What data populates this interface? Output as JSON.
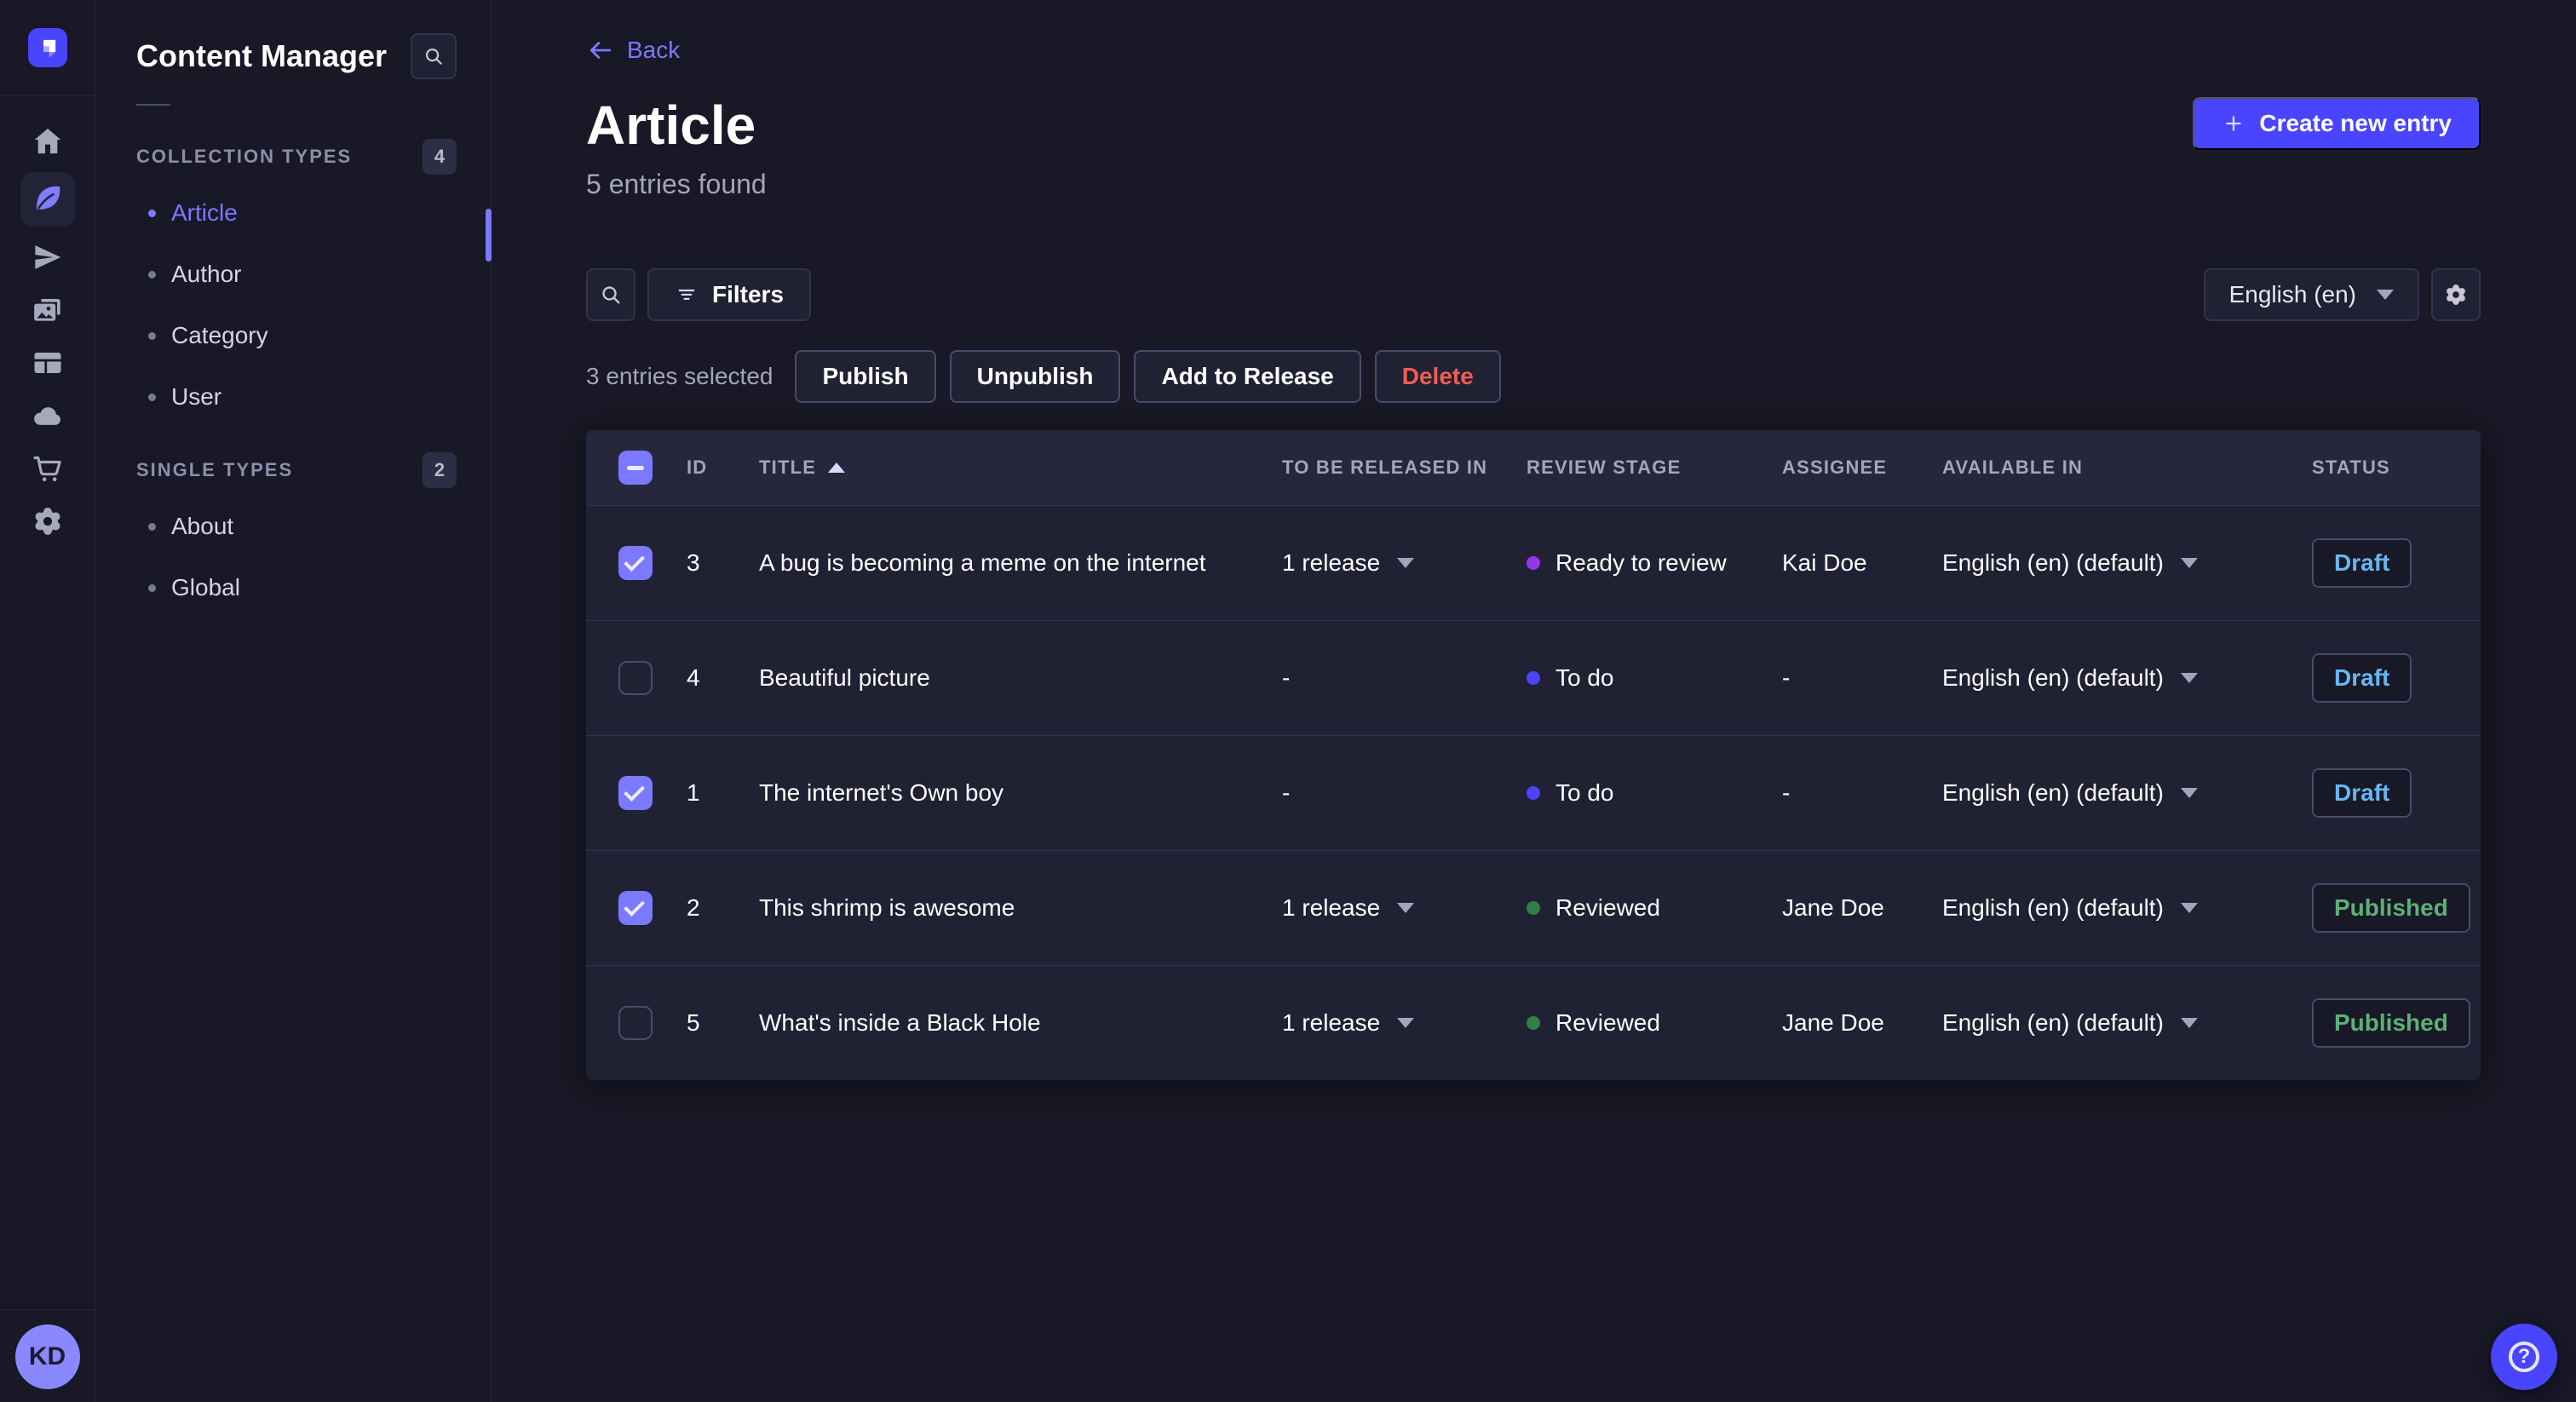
{
  "colors": {
    "primary": "#4945ff",
    "primary_light": "#7b79ff",
    "draft_text": "#66b7f1",
    "published_text": "#5cb176",
    "danger_text": "#ee5e52",
    "stage_ready_to_review": "#9736e8",
    "stage_to_do": "#4945ff",
    "stage_reviewed": "#328048"
  },
  "rail": {
    "avatar_initials": "KD",
    "icons": [
      "strapi-logo",
      "home",
      "content-manager",
      "releases",
      "media-library",
      "content-type-builder",
      "cloud",
      "marketplace",
      "settings"
    ],
    "active": "content-manager"
  },
  "subnav": {
    "title": "Content Manager",
    "sections": [
      {
        "label": "COLLECTION TYPES",
        "count": "4",
        "items": [
          {
            "label": "Article",
            "active": true
          },
          {
            "label": "Author",
            "active": false
          },
          {
            "label": "Category",
            "active": false
          },
          {
            "label": "User",
            "active": false
          }
        ]
      },
      {
        "label": "SINGLE TYPES",
        "count": "2",
        "items": [
          {
            "label": "About",
            "active": false
          },
          {
            "label": "Global",
            "active": false
          }
        ]
      }
    ]
  },
  "header": {
    "back_label": "Back",
    "title": "Article",
    "subtitle": "5 entries found",
    "create_label": "Create new entry"
  },
  "toolbar": {
    "filters_label": "Filters",
    "locale": "English (en)"
  },
  "selection": {
    "summary": "3 entries selected",
    "actions": [
      "Publish",
      "Unpublish",
      "Add to Release",
      "Delete"
    ]
  },
  "table": {
    "columns": [
      "ID",
      "TITLE",
      "TO BE RELEASED IN",
      "REVIEW STAGE",
      "ASSIGNEE",
      "AVAILABLE IN",
      "STATUS"
    ],
    "sort": {
      "column": "TITLE",
      "direction": "asc"
    },
    "rows": [
      {
        "checked": true,
        "id": "3",
        "title": "A bug is becoming a meme on the internet",
        "released_in": "1 release",
        "stage": "Ready to review",
        "assignee": "Kai Doe",
        "available_in": "English (en) (default)",
        "status": "Draft"
      },
      {
        "checked": false,
        "id": "4",
        "title": "Beautiful picture",
        "released_in": "-",
        "stage": "To do",
        "assignee": "-",
        "available_in": "English (en) (default)",
        "status": "Draft"
      },
      {
        "checked": true,
        "id": "1",
        "title": "The internet's Own boy",
        "released_in": "-",
        "stage": "To do",
        "assignee": "-",
        "available_in": "English (en) (default)",
        "status": "Draft"
      },
      {
        "checked": true,
        "id": "2",
        "title": "This shrimp is awesome",
        "released_in": "1 release",
        "stage": "Reviewed",
        "assignee": "Jane Doe",
        "available_in": "English (en) (default)",
        "status": "Published"
      },
      {
        "checked": false,
        "id": "5",
        "title": "What's inside a Black Hole",
        "released_in": "1 release",
        "stage": "Reviewed",
        "assignee": "Jane Doe",
        "available_in": "English (en) (default)",
        "status": "Published"
      }
    ]
  },
  "help": {
    "icon": "?"
  }
}
